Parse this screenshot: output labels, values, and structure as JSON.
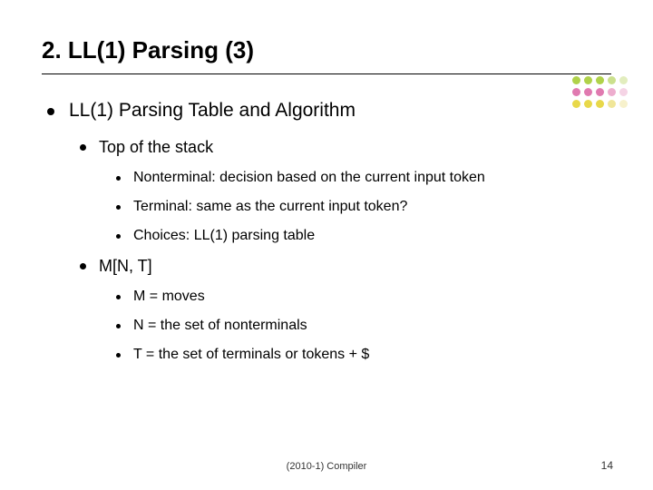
{
  "title": "2. LL(1) Parsing (3)",
  "l1": {
    "text": "LL(1) Parsing Table and Algorithm"
  },
  "l2a": {
    "text": "Top of the stack"
  },
  "l3a": {
    "text": "Nonterminal: decision based on the current input token"
  },
  "l3b": {
    "text": "Terminal: same as the current input token?"
  },
  "l3c": {
    "text": "Choices: LL(1) parsing table"
  },
  "l2b": {
    "text": "M[N, T]"
  },
  "l3d": {
    "text": "M = moves"
  },
  "l3e": {
    "text": "N = the set of nonterminals"
  },
  "l3f": {
    "text": "T = the set of terminals or tokens + $"
  },
  "footer_center": "(2010-1) Compiler",
  "footer_right": "14",
  "dot_colors": {
    "row1": [
      "#b0d24a",
      "#b0d24a",
      "#b0d24a",
      "#cbe08d",
      "#e2edbe"
    ],
    "row2": [
      "#e07ab0",
      "#e07ab0",
      "#e07ab0",
      "#edadce",
      "#f5d4e5"
    ],
    "row3": [
      "#e8d84a",
      "#e8d84a",
      "#e8d84a",
      "#f0e699",
      "#f7f1cc"
    ]
  }
}
